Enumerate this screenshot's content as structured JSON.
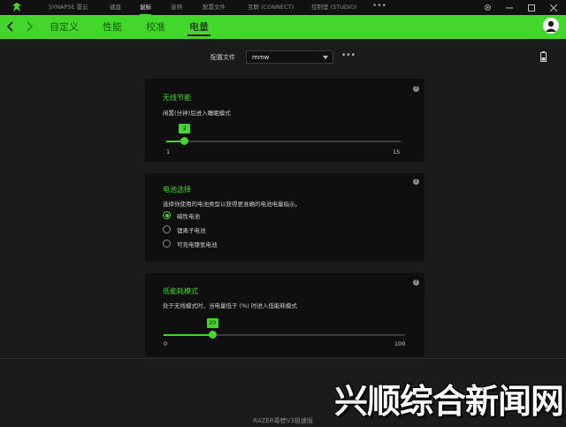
{
  "title_bar": {
    "nav_items": [
      {
        "label": "SYNAPSE 雷云",
        "active": false
      },
      {
        "label": "键盘",
        "active": false
      },
      {
        "label": "鼠标",
        "active": true
      },
      {
        "label": "音频",
        "active": false
      },
      {
        "label": "配置文件",
        "active": false
      },
      {
        "label": "互联 (CONNECT)",
        "active": false
      },
      {
        "label": "控制室 (STUDIO)",
        "active": false
      }
    ],
    "more_label": "•••"
  },
  "sub_nav": {
    "tabs": [
      {
        "label": "自定义",
        "active": false
      },
      {
        "label": "性能",
        "active": false
      },
      {
        "label": "校准",
        "active": false
      },
      {
        "label": "电量",
        "active": true
      }
    ]
  },
  "profile": {
    "label": "配置文件",
    "selected": "mmw",
    "more_label": "•••"
  },
  "sleep_card": {
    "title": "无线节能",
    "description": "闲置(分钟)后进入睡眠模式",
    "value": "2",
    "min": "1",
    "max": "15",
    "help_label": "?"
  },
  "battery_card": {
    "title": "电池选择",
    "description": "选择你使用的电池类型以获得更准确的电池电量指示。",
    "options": [
      {
        "label": "碱性电池",
        "checked": true
      },
      {
        "label": "锂离子电池",
        "checked": false
      },
      {
        "label": "可充电镍氢电池",
        "checked": false
      }
    ],
    "help_label": "?"
  },
  "low_power_card": {
    "title": "低能耗模式",
    "description": "处于无线模式时，当电量低于 (%) 时进入低能耗模式",
    "value": "20",
    "min": "0",
    "max": "100",
    "help_label": "?"
  },
  "footer": {
    "device_name": "RAZER毒蝰V3极速版"
  },
  "watermark": {
    "text": "兴顺综合新闻网"
  },
  "colors": {
    "accent": "#44d62c",
    "background": "#1b1b1b",
    "card": "#0f0f0f",
    "titlebar": "#111111"
  }
}
